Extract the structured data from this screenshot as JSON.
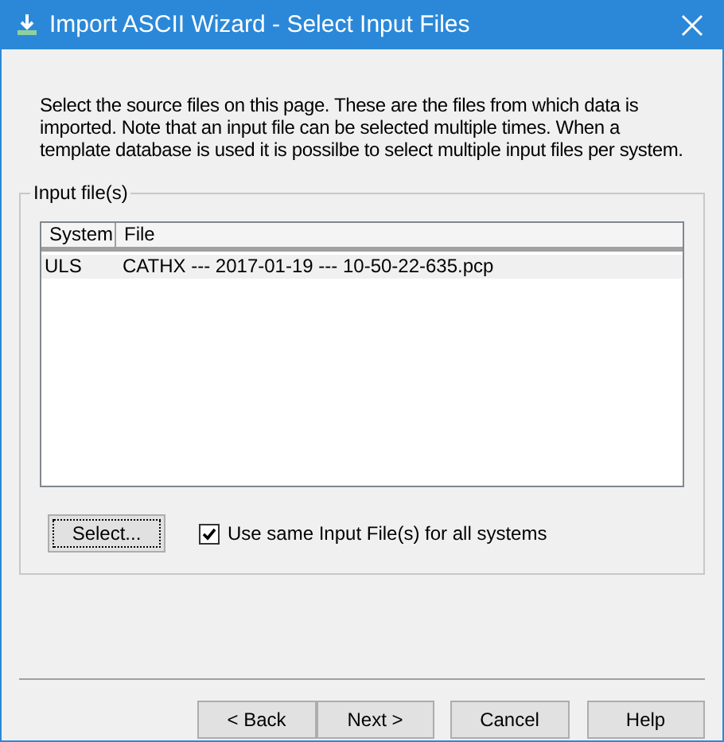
{
  "window": {
    "title": "Import ASCII Wizard - Select Input Files"
  },
  "intro": "Select the source files on this page. These are the files from which data is imported. Note that an input file can be selected multiple times. When a template database is used it is possilbe to select multiple input files per system.",
  "group": {
    "title": "Input file(s)",
    "table": {
      "columns": [
        "System",
        "File"
      ],
      "rows": [
        {
          "cells": [
            "ULS",
            "CATHX --- 2017-01-19 --- 10-50-22-635.pcp"
          ],
          "selected": true
        }
      ]
    },
    "select_button": "Select...",
    "same_files": {
      "label": "Use same Input File(s) for all systems",
      "checked": true
    }
  },
  "buttons": [
    "< Back",
    "Next >",
    "Cancel",
    "Help"
  ]
}
